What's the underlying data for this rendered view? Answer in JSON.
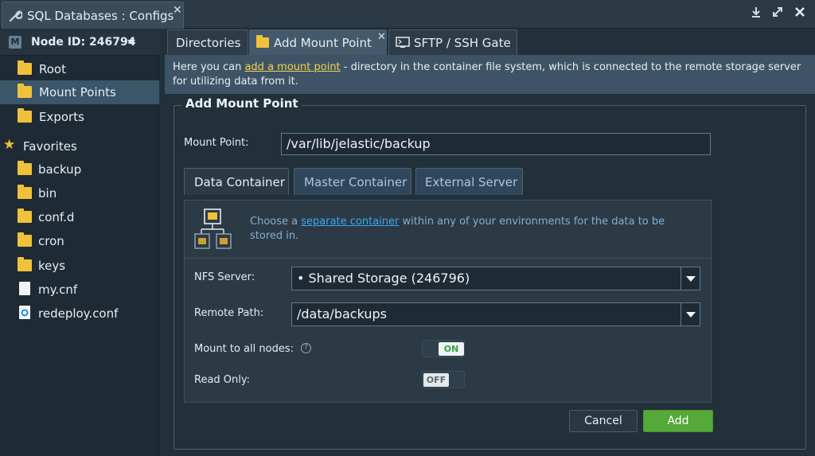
{
  "window": {
    "title": "SQL Databases : Configs",
    "controls": [
      "download-icon",
      "expand-icon",
      "close-icon"
    ]
  },
  "sidebar": {
    "node_selector": {
      "badge": "M",
      "label": "Node ID: 246794"
    },
    "items": [
      {
        "label": "Root",
        "icon": "folder-icon"
      },
      {
        "label": "Mount Points",
        "icon": "mount-folder-icon",
        "selected": true
      },
      {
        "label": "Exports",
        "icon": "exports-icon"
      }
    ],
    "favorites_label": "Favorites",
    "favorites": [
      {
        "label": "backup",
        "icon": "folder-icon"
      },
      {
        "label": "bin",
        "icon": "folder-icon"
      },
      {
        "label": "conf.d",
        "icon": "folder-icon"
      },
      {
        "label": "cron",
        "icon": "folder-icon"
      },
      {
        "label": "keys",
        "icon": "folder-icon"
      },
      {
        "label": "my.cnf",
        "icon": "file-icon"
      },
      {
        "label": "redeploy.conf",
        "icon": "config-file-icon"
      }
    ]
  },
  "tabs": [
    {
      "label": "Directories"
    },
    {
      "label": "Add Mount Point",
      "active": true,
      "closable": true
    },
    {
      "label": "SFTP / SSH Gate"
    }
  ],
  "info": {
    "prefix": "Here you can ",
    "link": "add a mount point",
    "suffix": " - directory in the container file system, which is connected to the remote storage server for utilizing data from it."
  },
  "form": {
    "legend": "Add Mount Point",
    "mount_point_label": "Mount Point:",
    "mount_point_value": "/var/lib/jelastic/backup",
    "source_tabs": [
      {
        "label": "Data Container",
        "active": true
      },
      {
        "label": "Master Container"
      },
      {
        "label": "External Server"
      }
    ],
    "desc_prefix": "Choose a ",
    "desc_link": "separate container",
    "desc_suffix": " within any of your environments for the data to be stored in.",
    "nfs_server_label": "NFS Server:",
    "nfs_server_value": "• Shared Storage (246796)",
    "remote_path_label": "Remote Path:",
    "remote_path_value": "/data/backups",
    "mount_all_label": "Mount to all nodes:",
    "mount_all_help": "?",
    "mount_all_state": "ON",
    "read_only_label": "Read Only:",
    "read_only_state": "OFF",
    "cancel_label": "Cancel",
    "add_label": "Add"
  },
  "colors": {
    "accent_green": "#55a83a",
    "link_yellow": "#f5d24a",
    "link_blue": "#39a9ee",
    "folder": "#f0c23b"
  }
}
